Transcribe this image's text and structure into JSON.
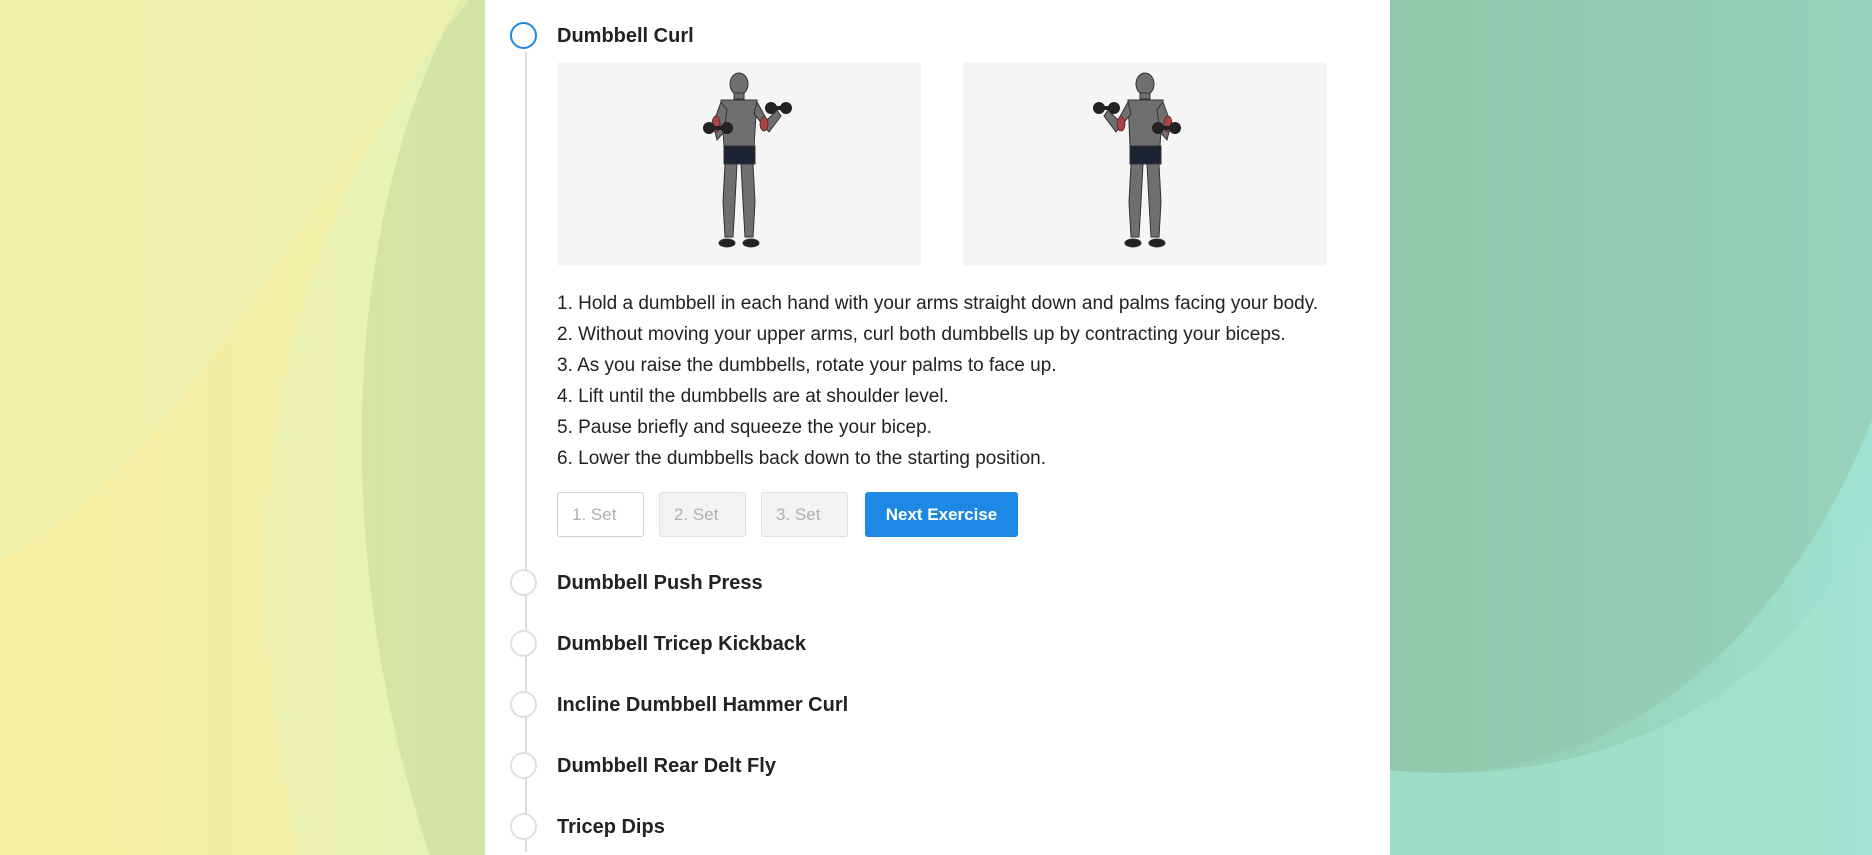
{
  "current_exercise": {
    "title": "Dumbbell Curl",
    "images": [
      {
        "alt": "",
        "icon": "dumbbell-curl-start-figure"
      },
      {
        "alt": "",
        "icon": "dumbbell-curl-end-figure"
      }
    ],
    "instructions": [
      "1. Hold a dumbbell in each hand with your arms straight down and palms facing your body.",
      "2. Without moving your upper arms, curl both dumbbells up by contracting your biceps.",
      "3. As you raise the dumbbells, rotate your palms to face up.",
      "4. Lift until the dumbbells are at shoulder level.",
      "5. Pause briefly and squeeze the your bicep.",
      "6. Lower the dumbbells back down to the starting position."
    ],
    "sets": [
      {
        "placeholder": "1. Set",
        "value": "",
        "enabled": true
      },
      {
        "placeholder": "2. Set",
        "value": "",
        "enabled": false
      },
      {
        "placeholder": "3. Set",
        "value": "",
        "enabled": false
      }
    ],
    "next_button_label": "Next Exercise"
  },
  "upcoming_exercises": [
    {
      "title": "Dumbbell Push Press"
    },
    {
      "title": "Dumbbell Tricep Kickback"
    },
    {
      "title": "Incline Dumbbell Hammer Curl"
    },
    {
      "title": "Dumbbell Rear Delt Fly"
    },
    {
      "title": "Tricep Dips"
    }
  ],
  "colors": {
    "accent": "#1e88e5",
    "circle_inactive": "#e0e0e0",
    "panel": "#ffffff"
  }
}
